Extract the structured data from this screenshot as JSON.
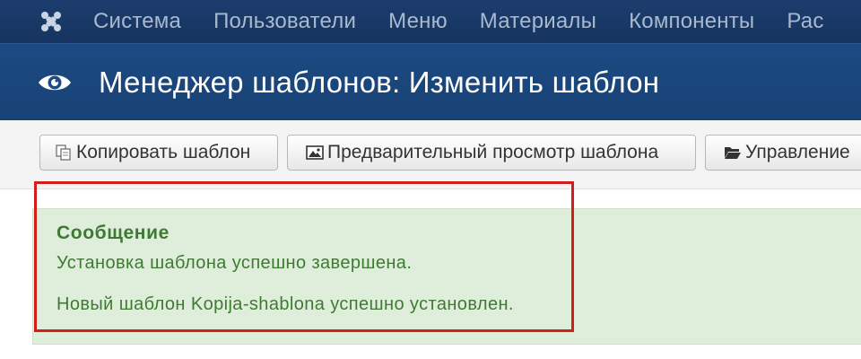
{
  "navbar": {
    "logo_icon": "joomla-logo-icon",
    "items": [
      {
        "label": "Система"
      },
      {
        "label": "Пользователи"
      },
      {
        "label": "Меню"
      },
      {
        "label": "Материалы"
      },
      {
        "label": "Компоненты"
      },
      {
        "label": "Рас"
      }
    ]
  },
  "header": {
    "icon": "eye-icon",
    "title": "Менеджер шаблонов: Изменить шаблон"
  },
  "toolbar": {
    "copy_label": "Копировать шаблон",
    "copy_icon": "copy-icon",
    "preview_label": "Предварительный просмотр шаблона",
    "preview_icon": "image-icon",
    "manage_label": "Управление",
    "manage_icon": "folder-open-icon"
  },
  "message": {
    "title": "Сообщение",
    "lines": [
      "Установка шаблона успешно завершена.",
      "Новый шаблон Kopija-shablona успешно установлен."
    ],
    "colors": {
      "background": "#dfeedb",
      "text": "#3f7a33",
      "highlight_border": "#d41c1c"
    }
  },
  "colors": {
    "navbar": "#1c3d6e",
    "header": "#1c4a82"
  }
}
